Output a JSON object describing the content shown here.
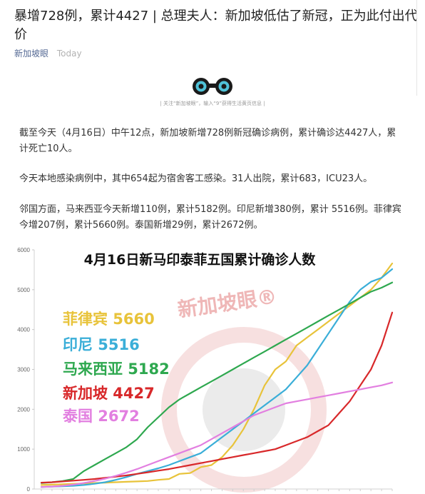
{
  "article": {
    "title": "暴增728例，累计4427 | 总理夫人：新加坡低估了新冠，正为此付出代价",
    "author": "新加坡眼",
    "date": "Today",
    "follow_text": "| 关注“新加坡眼”，输入“9”获得生活黄页信息 |",
    "paragraphs": [
      "截至今天（4月16日）中午12点，新加坡新增728例新冠确诊病例，累计确诊达4427人，累计死亡10人。",
      "今天本地感染病例中，其中654起为宿舍客工感染。31人出院，累计683，ICU23人。",
      "邻国方面，马来西亚今天新增110例，累计5182例。印尼新增380例，累计 5516例。菲律宾今增207例，累计5660例。泰国新增29例，累计2672例。"
    ]
  },
  "colors": {
    "philippines": "#e8c33a",
    "indonesia": "#3aaed8",
    "malaysia": "#2ea84f",
    "singapore": "#d8282a",
    "thailand": "#e27fe0",
    "author_link": "#576b95"
  },
  "chart_data": {
    "type": "line",
    "title": "4月16日新马印泰菲五国累计确诊人数",
    "watermark": "新加坡眼®",
    "ylim": [
      0,
      6000
    ],
    "yticks": [
      0,
      1000,
      2000,
      3000,
      4000,
      5000,
      6000
    ],
    "series": [
      {
        "name": "菲律宾",
        "label": "菲律宾 5660",
        "color": "#e8c33a",
        "values": [
          100,
          110,
          120,
          130,
          140,
          150,
          160,
          170,
          180,
          190,
          200,
          230,
          250,
          380,
          400,
          550,
          600,
          800,
          1100,
          1500,
          2000,
          2600,
          3000,
          3200,
          3600,
          3800,
          4000,
          4200,
          4400,
          4600,
          4800,
          5000,
          5300,
          5660
        ]
      },
      {
        "name": "印尼",
        "label": "印尼 5516",
        "color": "#3aaed8",
        "values": [
          50,
          60,
          70,
          80,
          100,
          130,
          170,
          230,
          300,
          380,
          450,
          520,
          600,
          700,
          800,
          900,
          1100,
          1300,
          1500,
          1700,
          1900,
          2100,
          2300,
          2500,
          2800,
          3100,
          3500,
          3900,
          4300,
          4700,
          5000,
          5200,
          5300,
          5516
        ]
      },
      {
        "name": "马来西亚",
        "label": "马来西亚 5182",
        "color": "#2ea84f",
        "values": [
          150,
          170,
          200,
          250,
          450,
          600,
          750,
          900,
          1050,
          1250,
          1550,
          1800,
          2050,
          2250,
          2400,
          2550,
          2700,
          2850,
          3000,
          3150,
          3300,
          3450,
          3600,
          3750,
          3900,
          4050,
          4200,
          4350,
          4500,
          4650,
          4800,
          4950,
          5050,
          5182
        ]
      },
      {
        "name": "新加坡",
        "label": "新加坡 4427",
        "color": "#d8282a",
        "values": [
          160,
          170,
          190,
          210,
          230,
          250,
          280,
          310,
          340,
          380,
          420,
          460,
          500,
          550,
          600,
          650,
          700,
          750,
          800,
          850,
          900,
          950,
          1000,
          1100,
          1200,
          1300,
          1450,
          1600,
          1900,
          2200,
          2600,
          3000,
          3600,
          4427
        ]
      },
      {
        "name": "泰国",
        "label": "泰国 2672",
        "color": "#e27fe0",
        "values": [
          50,
          60,
          80,
          110,
          150,
          200,
          260,
          330,
          410,
          500,
          600,
          700,
          800,
          900,
          1000,
          1100,
          1250,
          1400,
          1550,
          1700,
          1850,
          1950,
          2050,
          2150,
          2200,
          2250,
          2300,
          2350,
          2400,
          2450,
          2500,
          2550,
          2600,
          2672
        ]
      }
    ]
  }
}
